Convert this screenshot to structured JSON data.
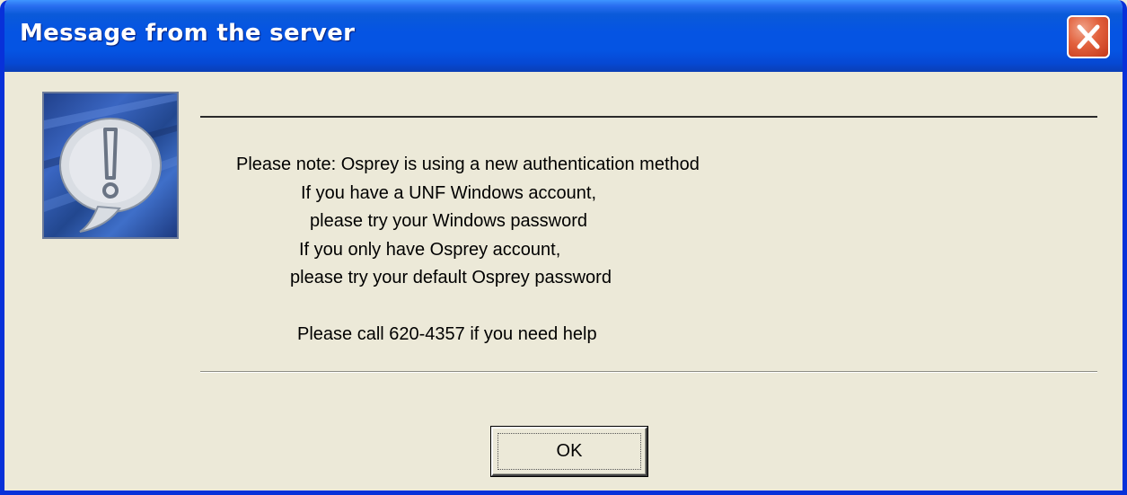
{
  "window": {
    "title": "Message from the server"
  },
  "message": {
    "lines": [
      "Please note: Osprey is using a new authentication method",
      "If you have a UNF Windows account,",
      "please try your Windows password",
      "If you only have Osprey account,",
      "please try your default Osprey password",
      "Please call 620-4357 if you need help"
    ]
  },
  "buttons": {
    "ok_label": "OK"
  },
  "icons": {
    "close": "close-icon",
    "message": "exclamation-speech-bubble-icon"
  },
  "colors": {
    "titlebar": "#0554e3",
    "window_face": "#ece9d8",
    "close_button": "#e2613d"
  }
}
